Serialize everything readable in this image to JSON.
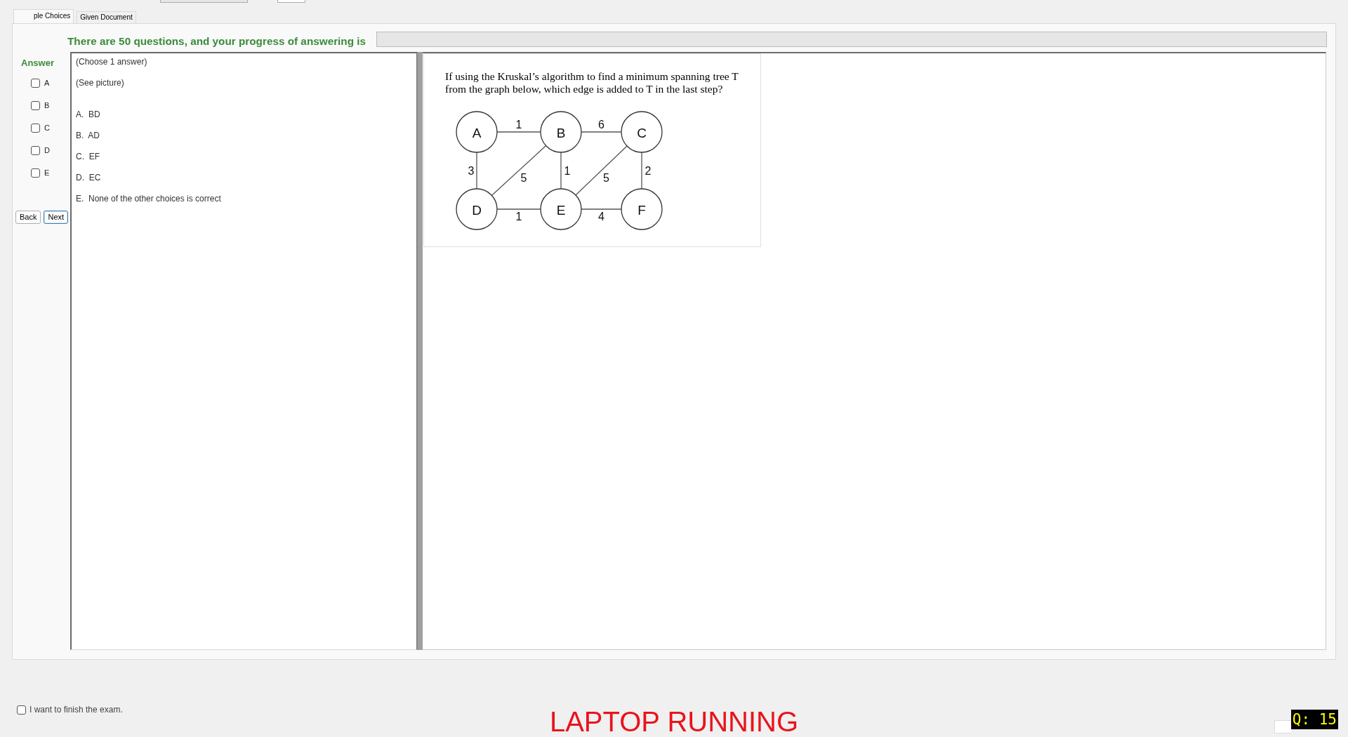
{
  "tabs": [
    {
      "label": "ple Choices",
      "selected": true
    },
    {
      "label": "Given Document",
      "selected": false
    }
  ],
  "progress": {
    "text": "There are 50 questions, and your progress of answering is",
    "level": 0
  },
  "answer_panel": {
    "title": "Answer",
    "options": [
      {
        "label": "A",
        "checked": false
      },
      {
        "label": "B",
        "checked": false
      },
      {
        "label": "C",
        "checked": false
      },
      {
        "label": "D",
        "checked": false
      },
      {
        "label": "E",
        "checked": false
      }
    ]
  },
  "buttons": [
    {
      "label": "Back",
      "focused": false
    },
    {
      "label": "Next",
      "focused": true
    }
  ],
  "question": {
    "notes": [
      "(Choose 1 answer)",
      "(See picture)"
    ],
    "choices": [
      "A.  BD",
      "B.  AD",
      "C.  EF",
      "D.  EC",
      "E.  None of the other choices is correct"
    ]
  },
  "picture": {
    "question": "If using the Kruskal’s algorithm to find a minimum spanning tree T from the graph below, which edge is added to T in the last step?",
    "graph": {
      "nodes": [
        "A",
        "B",
        "C",
        "D",
        "E",
        "F"
      ],
      "edges": [
        {
          "weight": "1"
        },
        {
          "weight": "6"
        },
        {
          "weight": "3"
        },
        {
          "weight": "5"
        },
        {
          "weight": "1"
        },
        {
          "weight": "5"
        },
        {
          "weight": "2"
        },
        {
          "weight": "1"
        },
        {
          "weight": "4"
        }
      ]
    }
  },
  "finish": {
    "label": "I want to finish the exam.",
    "checked": false
  },
  "status": "LAPTOP RUNNING",
  "question_counter": "Q: 15"
}
